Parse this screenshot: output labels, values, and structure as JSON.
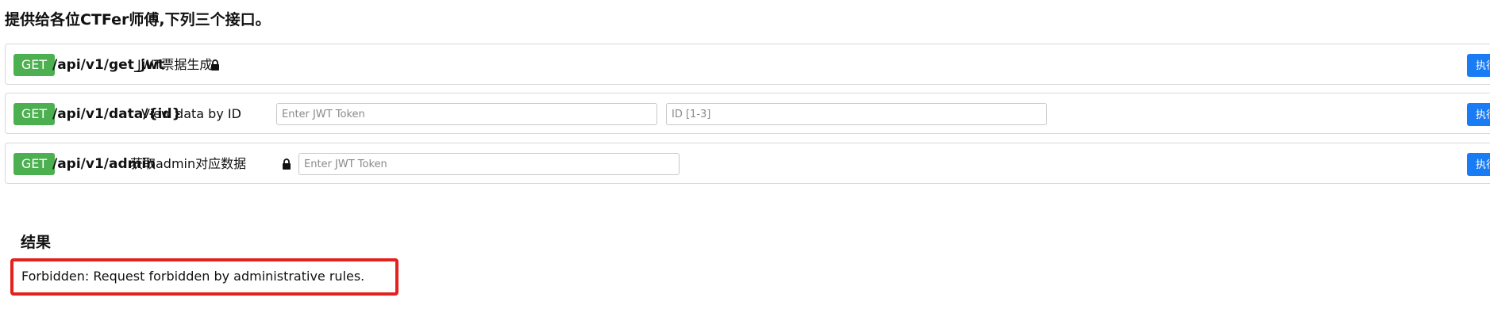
{
  "heading": "提供给各位CTFer师傅,下列三个接口。",
  "endpoints": [
    {
      "method": "GET",
      "path": "/api/v1/get_jwt",
      "description": "JWT票据生成",
      "locked": true,
      "execute_label": "执行"
    },
    {
      "method": "GET",
      "path": "/api/v1/data/{id}",
      "description": "View data by ID",
      "locked": false,
      "token_placeholder": "Enter JWT Token",
      "token_value": "",
      "id_placeholder": "ID [1-3]",
      "id_value": "",
      "execute_label": "执行"
    },
    {
      "method": "GET",
      "path": "/api/v1/admin",
      "description": "获取admin对应数据",
      "locked": true,
      "token_placeholder": "Enter JWT Token",
      "token_value": "",
      "execute_label": "执行"
    }
  ],
  "result": {
    "title": "结果",
    "message": "Forbidden: Request forbidden by administrative rules."
  },
  "colors": {
    "method_badge": "#4caf50",
    "execute_button": "#1a7cf5",
    "result_highlight": "#e5211d"
  },
  "icons": {
    "lock": "lock-icon"
  }
}
